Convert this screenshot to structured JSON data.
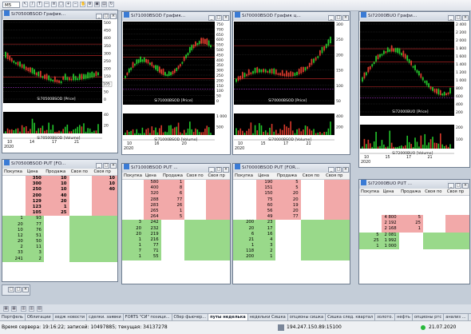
{
  "toolbar": {
    "timeframe": "M5",
    "search_value": ""
  },
  "charts": [
    {
      "title": "Si70500BSOD График...",
      "price_label": "Si70500BSOD [Price]",
      "volume_label": "Si70500BSOD [Volume]",
      "price_ticks": [
        "500",
        "450",
        "400",
        "350",
        "300",
        "250",
        "200",
        "150",
        "100",
        "50",
        "0"
      ],
      "price_tag": "105",
      "vol_ticks": [
        "40",
        "20"
      ],
      "x_ticks": [
        "10",
        "14",
        "17",
        "21"
      ],
      "year": "2020"
    },
    {
      "title": "Si71000BSOD График...",
      "price_label": "Si71000BSOD [Price]",
      "volume_label": "Si71000BSOD [Volume]",
      "price_ticks": [
        "750",
        "700",
        "650",
        "600",
        "550",
        "500",
        "450",
        "400",
        "350",
        "300",
        "250",
        "200",
        "150",
        "100",
        "50",
        "0"
      ],
      "price_tag": "",
      "vol_ticks": [
        "1 000",
        "500"
      ],
      "x_ticks": [
        "10",
        "16",
        "20"
      ],
      "year": "2020"
    },
    {
      "title": "Si70000BSOD График ц...",
      "price_label": "Si70000BSOD [Price]",
      "volume_label": "Si70000BSOD [Volume]",
      "price_ticks": [
        "300",
        "250",
        "200",
        "150",
        "100",
        "50"
      ],
      "price_tag": "",
      "vol_ticks": [
        "400",
        "200"
      ],
      "x_ticks": [
        "10",
        "15",
        "17",
        "21"
      ],
      "year": "2020"
    },
    {
      "title": "Si72000BUO Графи...",
      "price_label": "Si72000BUO [Price]",
      "volume_label": "Si72000BUO [Volume]",
      "price_ticks": [
        "2 400",
        "2 200",
        "2 000",
        "1 800",
        "1 600",
        "1 400",
        "1 200",
        "1 000",
        "800",
        "600",
        "400",
        "200"
      ],
      "price_tag": "",
      "vol_ticks": [
        "200",
        "100"
      ],
      "x_ticks": [
        "10",
        "15",
        "17",
        "21"
      ],
      "year": "2020"
    }
  ],
  "books": [
    {
      "title": "Si70500BSOD PUT [FO...",
      "headers": [
        "Покупка",
        "Цена",
        "Продажа",
        "Своя по",
        "Своя пр"
      ],
      "rows": [
        [
          "",
          "350",
          "10",
          "",
          "10"
        ],
        [
          "",
          "300",
          "10",
          "",
          "10"
        ],
        [
          "",
          "250",
          "10",
          "",
          "40"
        ],
        [
          "",
          "200",
          "40",
          "",
          ""
        ],
        [
          "",
          "129",
          "20",
          "",
          ""
        ],
        [
          "",
          "123",
          "1",
          "",
          ""
        ],
        [
          "",
          "105",
          "25",
          "",
          ""
        ],
        [
          "1",
          "93",
          "",
          "",
          ""
        ],
        [
          "20",
          "77",
          "",
          "",
          ""
        ],
        [
          "10",
          "76",
          "",
          "",
          ""
        ],
        [
          "12",
          "51",
          "",
          "",
          ""
        ],
        [
          "20",
          "50",
          "",
          "",
          ""
        ],
        [
          "2",
          "11",
          "",
          "",
          ""
        ],
        [
          "33",
          "3",
          "",
          "",
          ""
        ],
        [
          "241",
          "2",
          "",
          "",
          ""
        ]
      ]
    },
    {
      "title": "Si71000BSOD PUT ...",
      "headers": [
        "Покупка",
        "Цена",
        "Продажа",
        "Своя по",
        "Своя пр"
      ],
      "rows": [
        [
          "",
          "580",
          "1",
          "",
          ""
        ],
        [
          "",
          "400",
          "8",
          "",
          ""
        ],
        [
          "",
          "320",
          "6",
          "",
          ""
        ],
        [
          "",
          "288",
          "77",
          "",
          ""
        ],
        [
          "",
          "283",
          "26",
          "",
          ""
        ],
        [
          "",
          "265",
          "1",
          "",
          ""
        ],
        [
          "",
          "264",
          "5",
          "",
          ""
        ],
        [
          "3",
          "242",
          "",
          "",
          ""
        ],
        [
          "20",
          "232",
          "",
          "",
          ""
        ],
        [
          "20",
          "219",
          "",
          "",
          ""
        ],
        [
          "1",
          "216",
          "",
          "",
          ""
        ],
        [
          "1",
          "77",
          "",
          "",
          ""
        ],
        [
          "7",
          "71",
          "",
          "",
          ""
        ],
        [
          "1",
          "55",
          "",
          "",
          ""
        ]
      ]
    },
    {
      "title": "Si70000BSOD PUT [FOR...",
      "headers": [
        "Покупка",
        "Цена",
        "Продажа",
        "Своя по",
        "Своя пр"
      ],
      "rows": [
        [
          "",
          "190",
          "5",
          "",
          ""
        ],
        [
          "",
          "151",
          "5",
          "",
          ""
        ],
        [
          "",
          "150",
          "20",
          "",
          ""
        ],
        [
          "",
          "75",
          "20",
          "",
          ""
        ],
        [
          "",
          "60",
          "19",
          "",
          ""
        ],
        [
          "",
          "56",
          "20",
          "",
          ""
        ],
        [
          "",
          "49",
          "77",
          "",
          ""
        ],
        [
          "200",
          "23",
          "",
          "",
          ""
        ],
        [
          "20",
          "17",
          "",
          "",
          ""
        ],
        [
          "6",
          "16",
          "",
          "",
          ""
        ],
        [
          "21",
          "4",
          "",
          "",
          ""
        ],
        [
          "1",
          "3",
          "",
          "",
          ""
        ],
        [
          "118",
          "2",
          "",
          "",
          ""
        ],
        [
          "200",
          "1",
          "",
          "",
          ""
        ]
      ]
    },
    {
      "title": "Si72000BUO PUT ...",
      "headers": [
        "Покупка",
        "Цена",
        "Продажа",
        "Своя по",
        "Своя пр"
      ],
      "rows": [
        [
          "",
          "4 800",
          "5",
          "",
          ""
        ],
        [
          "",
          "2 192",
          "25",
          "",
          ""
        ],
        [
          "",
          "2 168",
          "1",
          "",
          ""
        ],
        [
          "5",
          "2 081",
          "",
          "",
          ""
        ],
        [
          "25",
          "1 992",
          "",
          "",
          ""
        ],
        [
          "1",
          "1 000",
          "",
          "",
          ""
        ]
      ]
    }
  ],
  "tabs": [
    "Портфель",
    "Облигации",
    "хедж новости",
    "сделки. заявки",
    "FORTS \"СИ\" позици...",
    "Сбер фьючер...",
    "путы неделька",
    "недельки Сишка",
    "опционы сишка",
    "Сишка след. квартал",
    "золото.",
    "нефть",
    "опционы ртс",
    "анализ ..."
  ],
  "status": {
    "server_time": "Время сервера: 19:16:22; записей: 10497885; текущая: 34137278",
    "ip": "194.247.150.89:15100",
    "date": "21.07.2020"
  },
  "colors": {
    "bid": "#99d98a",
    "ask": "#f2a9a9",
    "chart_bg": "#000000",
    "up": "#23c42b",
    "down": "#d83a2c"
  }
}
